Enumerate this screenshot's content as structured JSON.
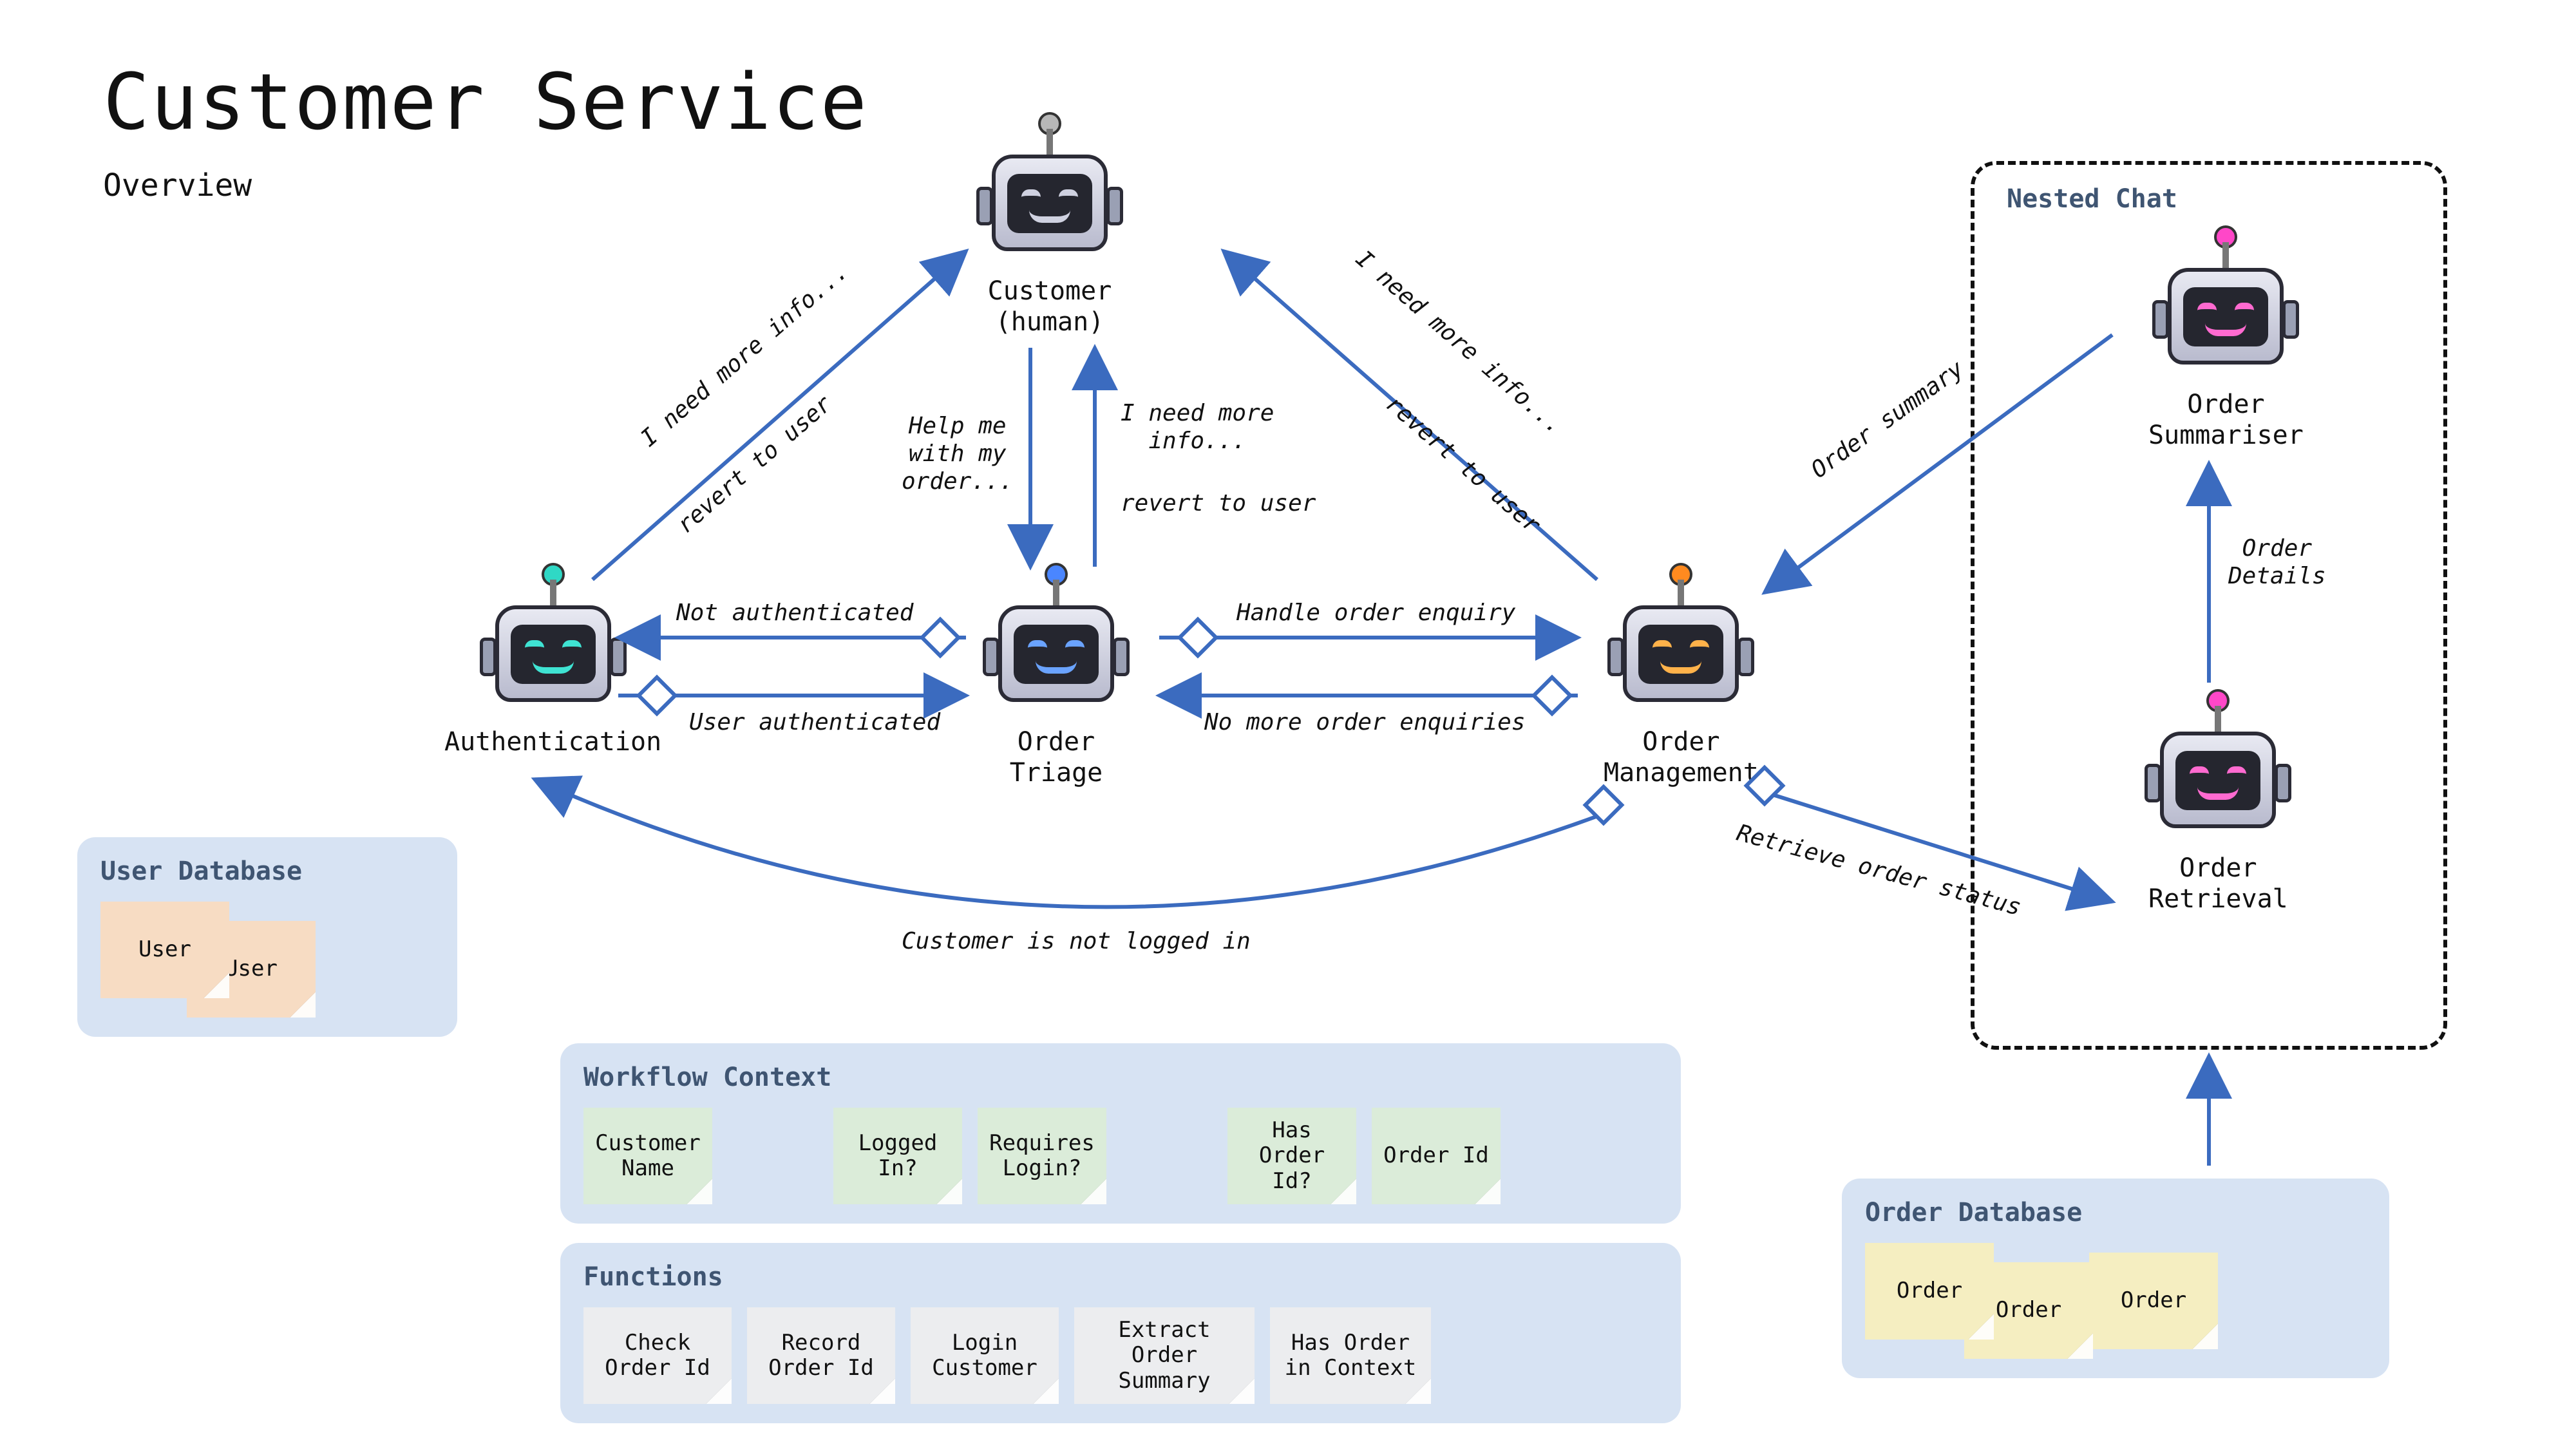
{
  "title": "Customer Service",
  "subtitle": "Overview",
  "agents": {
    "customer": {
      "label": "Customer\n(human)",
      "color": "grey"
    },
    "authentication": {
      "label": "Authentication",
      "color": "teal"
    },
    "order_triage": {
      "label": "Order\nTriage",
      "color": "blue"
    },
    "order_management": {
      "label": "Order\nManagement",
      "color": "orange"
    },
    "order_summariser": {
      "label": "Order\nSummariser",
      "color": "pink"
    },
    "order_retrieval": {
      "label": "Order\nRetrieval",
      "color": "pink"
    }
  },
  "nested_chat_title": "Nested Chat",
  "panels": {
    "user_db": {
      "title": "User Database",
      "notes": [
        "User",
        "User"
      ],
      "note_color": "peach"
    },
    "workflow": {
      "title": "Workflow Context",
      "notes": [
        "Customer\nName",
        "Logged\nIn?",
        "Requires\nLogin?",
        "Has\nOrder\nId?",
        "Order Id"
      ],
      "note_color": "green"
    },
    "functions": {
      "title": "Functions",
      "notes": [
        "Check\nOrder Id",
        "Record\nOrder Id",
        "Login\nCustomer",
        "Extract Order\nSummary",
        "Has Order\nin Context"
      ],
      "note_color": "grey"
    },
    "order_db": {
      "title": "Order Database",
      "notes": [
        "Order",
        "Order",
        "Order"
      ],
      "note_color": "yellow"
    }
  },
  "edges": {
    "auth_to_customer": {
      "label": "I need more info...",
      "sublabel": "revert to user"
    },
    "triage_to_customer_up": {
      "label": "I need more\ninfo...",
      "sublabel": "revert to user"
    },
    "customer_to_triage": {
      "label": "Help me\nwith my\norder..."
    },
    "mgmt_to_customer": {
      "label": "I need more info...",
      "sublabel": "revert to user"
    },
    "triage_to_auth": {
      "label": "Not authenticated"
    },
    "auth_to_triage": {
      "label": "User authenticated"
    },
    "triage_to_mgmt": {
      "label": "Handle order enquiry"
    },
    "mgmt_to_triage": {
      "label": "No more order enquiries"
    },
    "mgmt_to_auth_curve": {
      "label": "Customer is not logged in"
    },
    "mgmt_to_retrieval": {
      "label": "Retrieve order status"
    },
    "retrieval_to_summariser": {
      "label": "Order\nDetails"
    },
    "summariser_to_mgmt": {
      "label": "Order summary"
    },
    "orderdb_to_retrieval": {
      "label": ""
    }
  },
  "colors": {
    "arrow": "#3b6bbf",
    "panel": "#d7e3f3"
  }
}
